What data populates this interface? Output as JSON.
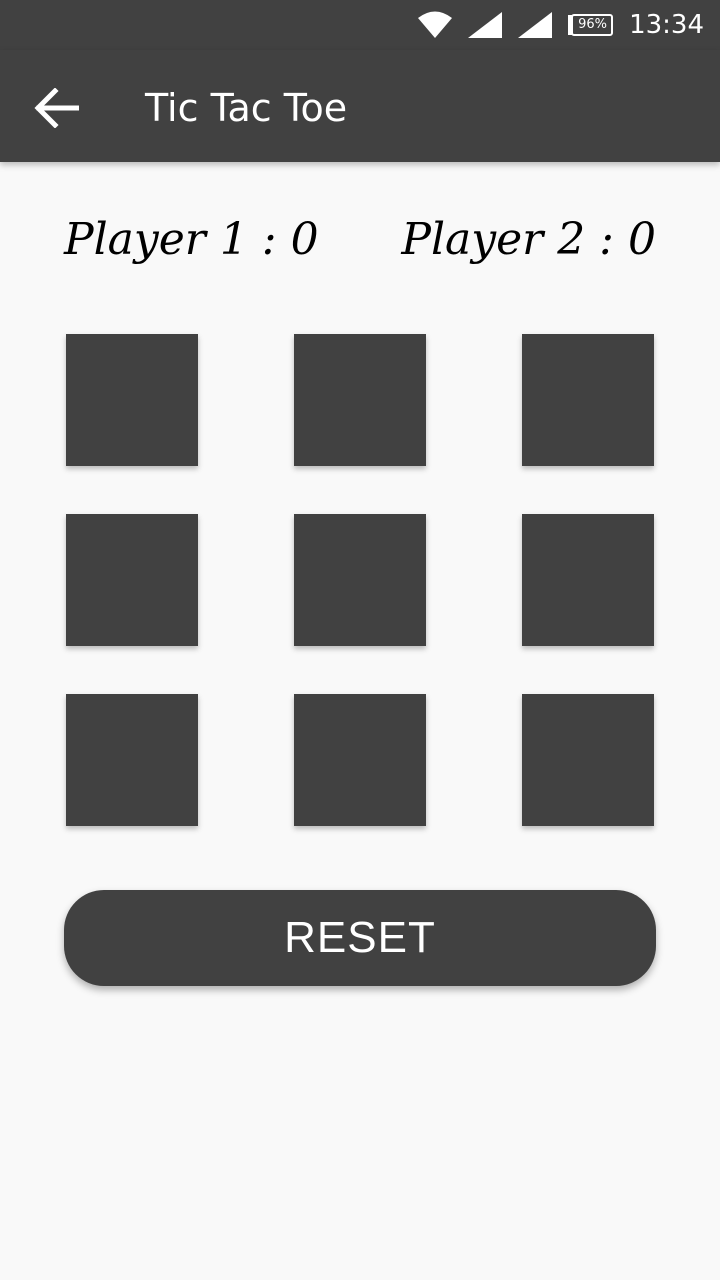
{
  "status_bar": {
    "battery_percent": "96%",
    "time": "13:34",
    "icons": [
      "wifi-icon",
      "signal-icon",
      "signal-icon",
      "battery-icon"
    ]
  },
  "app_bar": {
    "title": "Tic Tac Toe",
    "back_icon": "arrow-back-icon"
  },
  "scores": {
    "player1": "Player 1 : 0",
    "player2": "Player 2 : 0"
  },
  "board": {
    "cells": [
      "",
      "",
      "",
      "",
      "",
      "",
      "",
      "",
      ""
    ]
  },
  "reset_label": "RESET",
  "colors": {
    "primary": "#414141",
    "background": "#f9f9f9",
    "text_on_primary": "#ffffff",
    "score_text": "#000000"
  }
}
